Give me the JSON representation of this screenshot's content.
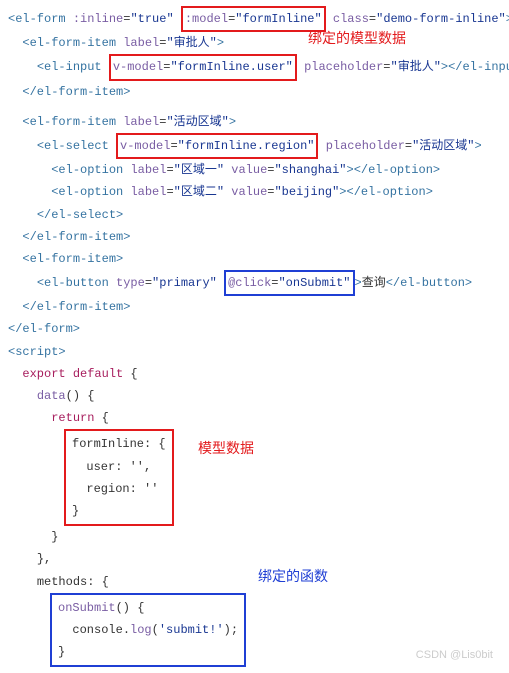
{
  "code": {
    "l1": {
      "tag_open": "<el-form ",
      "attr1_name": ":inline",
      "attr1_val": "\"true\"",
      "space1": " ",
      "boxed": ":model=\"formInline\"",
      "space2": " ",
      "attr3_name": "class",
      "attr3_val": "\"demo-form-inline\"",
      "close": ">"
    },
    "l2": {
      "indent": "  ",
      "tag_open": "<el-form-item ",
      "attr1_name": "label",
      "attr1_val": "\"审批人\"",
      "close": ">"
    },
    "l3": {
      "indent": "    ",
      "tag_open": "<el-input ",
      "boxed": "v-model=\"formInline.user\"",
      "space": " ",
      "attr2_name": "placeholder",
      "attr2_val": "\"审批人\"",
      "close": "></el-input>"
    },
    "l4": {
      "indent": "  ",
      "text": "</el-form-item>"
    },
    "l5": {
      "indent": "  ",
      "tag_open": "<el-form-item ",
      "attr1_name": "label",
      "attr1_val": "\"活动区域\"",
      "close": ">"
    },
    "l6": {
      "indent": "    ",
      "tag_open": "<el-select ",
      "boxed": "v-model=\"formInline.region\"",
      "space": " ",
      "attr2_name": "placeholder",
      "attr2_val": "\"活动区域\"",
      "close": ">"
    },
    "l7": {
      "indent": "      ",
      "tag_open": "<el-option ",
      "attr1_name": "label",
      "attr1_val": "\"区域一\"",
      "space1": " ",
      "attr2_name": "value",
      "attr2_val": "\"shanghai\"",
      "close": "></el-option>"
    },
    "l8": {
      "indent": "      ",
      "tag_open": "<el-option ",
      "attr1_name": "label",
      "attr1_val": "\"区域二\"",
      "space1": " ",
      "attr2_name": "value",
      "attr2_val": "\"beijing\"",
      "close": "></el-option>"
    },
    "l9": {
      "indent": "    ",
      "text": "</el-select>"
    },
    "l10": {
      "indent": "  ",
      "text": "</el-form-item>"
    },
    "l11": {
      "indent": "  ",
      "text": "<el-form-item>"
    },
    "l12": {
      "indent": "    ",
      "tag_open": "<el-button ",
      "attr1_name": "type",
      "attr1_val": "\"primary\"",
      "space1": " ",
      "boxed": "@click=\"onSubmit\"",
      "text_after": "查询",
      "close": "</el-button>"
    },
    "l13": {
      "indent": "  ",
      "text": "</el-form-item>"
    },
    "l14": {
      "text": "</el-form>"
    },
    "l15": {
      "text": "<script>"
    },
    "l16": {
      "indent": "  ",
      "kw": "export default",
      "rest": " {"
    },
    "l17": {
      "indent": "    ",
      "func": "data",
      "rest": "() {"
    },
    "l18": {
      "indent": "      ",
      "kw": "return",
      "rest": " {"
    },
    "block_data": {
      "l1": "formInline: {",
      "l2": "  user: '',",
      "l3": "  region: ''",
      "l4": "}"
    },
    "l23": {
      "indent": "      ",
      "text": "}"
    },
    "l24": {
      "indent": "    ",
      "text": "},"
    },
    "l25": {
      "indent": "    ",
      "text": "methods: {"
    },
    "block_method": {
      "l1_func": "onSubmit",
      "l1_rest": "() {",
      "l2_indent": "  ",
      "l2_obj": "console",
      "l2_dot": ".",
      "l2_func": "log",
      "l2_paren_open": "(",
      "l2_str": "'submit!'",
      "l2_paren_close": ");",
      "l3": "}"
    }
  },
  "annotations": {
    "top": "绑定的模型数据",
    "mid": "模型数据",
    "bottom": "绑定的函数"
  },
  "watermark": "CSDN @Lis0bit"
}
